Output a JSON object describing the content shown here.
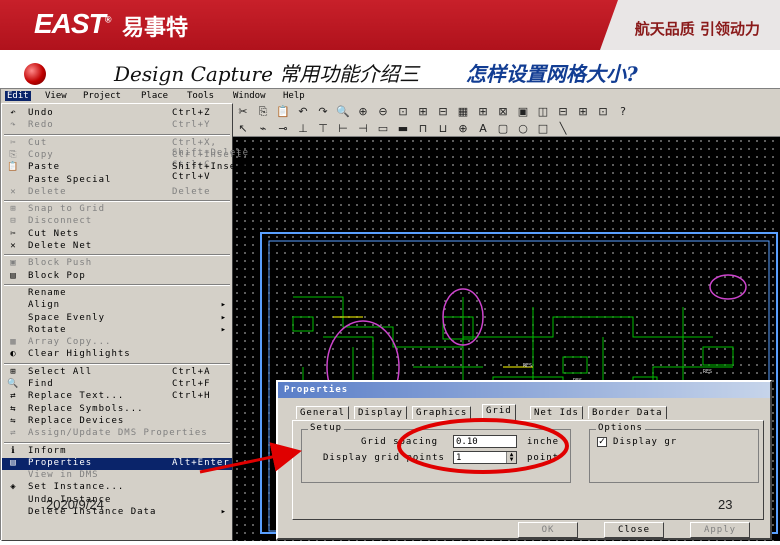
{
  "banner": {
    "logo": "EAST",
    "logo_registered": "®",
    "logo_cn": "易事特",
    "slogan": "航天品质 引领动力"
  },
  "slide": {
    "title": "Design Capture 常用功能介绍三",
    "title_cn": "怎样设置网格大小?",
    "date": "2020/9/24",
    "page": "23"
  },
  "menubar": [
    "Edit",
    "View",
    "Project",
    "Place",
    "Tools",
    "Window",
    "Help"
  ],
  "toolbar": {
    "row1": [
      "✂",
      "⎘",
      "📋",
      "↶",
      "↷",
      "🔍",
      "⊕",
      "⊖",
      "⊡",
      "⊞",
      "⊟",
      "▦",
      "⊞",
      "⊠",
      "▣",
      "◫",
      "⊟",
      "⊞",
      "⊡",
      "?"
    ],
    "row2": [
      "↖",
      "⌁",
      "⊸",
      "⊥",
      "⊤",
      "⊢",
      "⊣",
      "▭",
      "▬",
      "⊓",
      "⊔",
      "⊕",
      "A",
      "▢",
      "○",
      "□",
      "╲",
      "",
      "",
      ""
    ]
  },
  "edit_menu": {
    "items": [
      {
        "icon": "↶",
        "label": "Undo",
        "shortcut": "Ctrl+Z",
        "disabled": false,
        "selected": false
      },
      {
        "icon": "↷",
        "label": "Redo",
        "shortcut": "Ctrl+Y",
        "disabled": true,
        "selected": false
      },
      {
        "icon": "✂",
        "label": "Cut",
        "shortcut": "Ctrl+X, Shift+Delete",
        "disabled": true,
        "selected": false
      },
      {
        "icon": "⎘",
        "label": "Copy",
        "shortcut": "Ctrl+Insert, Ctrl+C",
        "disabled": true,
        "selected": false
      },
      {
        "icon": "📋",
        "label": "Paste",
        "shortcut": "Shift+Insert, Ctrl+V",
        "disabled": false,
        "selected": false
      },
      {
        "icon": "",
        "label": "Paste Special",
        "shortcut": "",
        "disabled": false,
        "selected": false
      },
      {
        "icon": "✕",
        "label": "Delete",
        "shortcut": "Delete",
        "disabled": true,
        "selected": false
      },
      {
        "icon": "⊞",
        "label": "Snap to Grid",
        "shortcut": "",
        "disabled": true,
        "selected": false
      },
      {
        "icon": "⊟",
        "label": "Disconnect",
        "shortcut": "",
        "disabled": true,
        "selected": false
      },
      {
        "icon": "✂",
        "label": "Cut Nets",
        "shortcut": "",
        "disabled": false,
        "selected": false
      },
      {
        "icon": "✕",
        "label": "Delete Net",
        "shortcut": "",
        "disabled": false,
        "selected": false
      },
      {
        "icon": "▣",
        "label": "Block Push",
        "shortcut": "",
        "disabled": true,
        "selected": false
      },
      {
        "icon": "▤",
        "label": "Block Pop",
        "shortcut": "",
        "disabled": false,
        "selected": false
      },
      {
        "icon": "",
        "label": "Rename",
        "shortcut": "",
        "disabled": false,
        "selected": false
      },
      {
        "icon": "",
        "label": "Align",
        "shortcut": "",
        "disabled": false,
        "selected": false,
        "submenu": true
      },
      {
        "icon": "",
        "label": "Space Evenly",
        "shortcut": "",
        "disabled": false,
        "selected": false,
        "submenu": true
      },
      {
        "icon": "",
        "label": "Rotate",
        "shortcut": "",
        "disabled": false,
        "selected": false,
        "submenu": true
      },
      {
        "icon": "▦",
        "label": "Array Copy...",
        "shortcut": "",
        "disabled": true,
        "selected": false
      },
      {
        "icon": "◐",
        "label": "Clear Highlights",
        "shortcut": "",
        "disabled": false,
        "selected": false
      },
      {
        "icon": "⊞",
        "label": "Select All",
        "shortcut": "Ctrl+A",
        "disabled": false,
        "selected": false
      },
      {
        "icon": "🔍",
        "label": "Find",
        "shortcut": "Ctrl+F",
        "disabled": false,
        "selected": false
      },
      {
        "icon": "⇄",
        "label": "Replace Text...",
        "shortcut": "Ctrl+H",
        "disabled": false,
        "selected": false
      },
      {
        "icon": "⇆",
        "label": "Replace Symbols...",
        "shortcut": "",
        "disabled": false,
        "selected": false
      },
      {
        "icon": "⇋",
        "label": "Replace Devices",
        "shortcut": "",
        "disabled": false,
        "selected": false
      },
      {
        "icon": "⇌",
        "label": "Assign/Update DMS Properties",
        "shortcut": "",
        "disabled": true,
        "selected": false
      },
      {
        "icon": "ℹ",
        "label": "Inform",
        "shortcut": "",
        "disabled": false,
        "selected": false
      },
      {
        "icon": "▤",
        "label": "Properties",
        "shortcut": "Alt+Enter",
        "disabled": false,
        "selected": true
      },
      {
        "icon": "",
        "label": "View in DMS",
        "shortcut": "",
        "disabled": true,
        "selected": false
      },
      {
        "icon": "◈",
        "label": "Set Instance...",
        "shortcut": "",
        "disabled": false,
        "selected": false
      },
      {
        "icon": "",
        "label": "Undo Instance",
        "shortcut": "",
        "disabled": false,
        "selected": false
      },
      {
        "icon": "",
        "label": "Delete Instance Data",
        "shortcut": "",
        "disabled": false,
        "selected": false,
        "submenu": true
      }
    ]
  },
  "dialog": {
    "title": "Properties",
    "tabs": [
      "General",
      "Display",
      "Graphics",
      "Grid",
      "Net Ids",
      "Border Data"
    ],
    "active_tab": "Grid",
    "setup": {
      "title": "Setup",
      "grid_spacing_label": "Grid spacing",
      "grid_spacing_value": "0.10",
      "grid_spacing_unit": "inche",
      "display_grid_label": "Display grid points",
      "display_grid_value": "1",
      "display_grid_unit": "point"
    },
    "options": {
      "title": "Options",
      "display_gr_label": "Display gr",
      "checked": true
    },
    "buttons": {
      "ok": "OK",
      "close": "Close",
      "apply": "Apply"
    }
  },
  "colors": {
    "banner": "#b0121c",
    "highlight": "#0a246a",
    "annotation": "#e00000",
    "wire": "#5aa0ff",
    "wire_green": "#00c000"
  }
}
